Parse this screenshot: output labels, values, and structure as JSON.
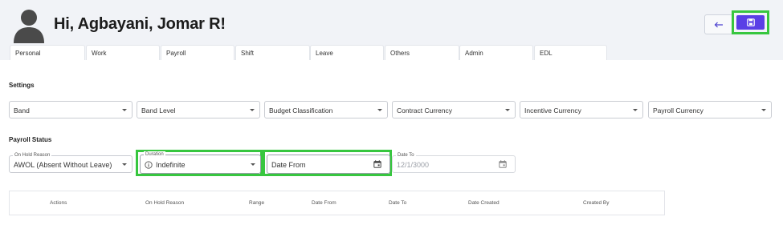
{
  "header": {
    "greeting": "Hi, Agbayani, Jomar R!",
    "back_icon": "arrow-left-icon",
    "save_icon": "save-icon"
  },
  "tabs": [
    "Personal",
    "Work",
    "Payroll",
    "Shift",
    "Leave",
    "Others",
    "Admin",
    "EDL"
  ],
  "active_tab": "Admin",
  "settings": {
    "title": "Settings",
    "fields": [
      "Band",
      "Band Level",
      "Budget Classification",
      "Contract Currency",
      "Incentive Currency",
      "Payroll Currency"
    ]
  },
  "payroll_status": {
    "title": "Payroll Status",
    "on_hold_reason": {
      "label": "On Hold Reason",
      "value": "AWOL (Absent Without Leave)"
    },
    "duration": {
      "label": "Duration",
      "value": "Indefinite"
    },
    "date_from": {
      "placeholder": "Date From"
    },
    "date_to": {
      "label": "Date To",
      "value": "12/1/3000"
    }
  },
  "table": {
    "columns": [
      "Actions",
      "On Hold Reason",
      "Range",
      "Date From",
      "Date To",
      "Date Created",
      "Created By"
    ]
  },
  "colors": {
    "accent": "#5a3fe6",
    "highlight": "#37c63f",
    "header_bg": "#f1f3f7"
  }
}
